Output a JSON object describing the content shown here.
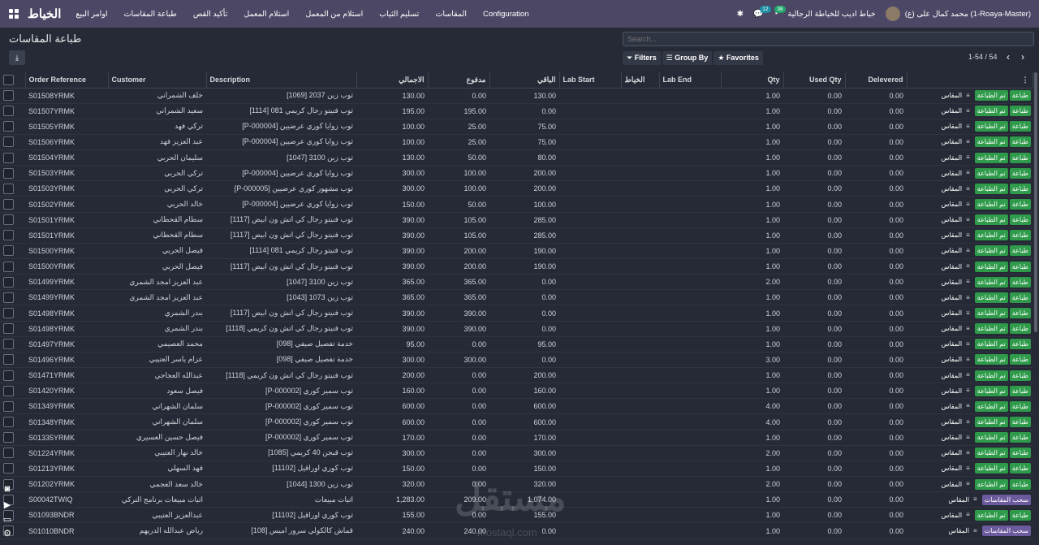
{
  "navbar": {
    "brand": "الخياط",
    "menu": [
      "اوامر البيع",
      "طباعة المقاسات",
      "تأكيد القص",
      "استلام المعمل",
      "استلام من المعمل",
      "تسليم الثياب",
      "المقاسات",
      "Configuration"
    ],
    "messages_count": "12",
    "activity_count": "38",
    "company": "خياط اديب للخياطة الرجالية",
    "user": "محمد كمال على (ع) (1-Roaya-Master)"
  },
  "page": {
    "title": "طباعة المقاسات",
    "search_placeholder": "Search...",
    "filters_label": "Filters",
    "groupby_label": "Group By",
    "favorites_label": "Favorites",
    "pager": "1-54 / 54"
  },
  "columns": [
    "Order Reference",
    "Customer",
    "Description",
    "الاجمالي",
    "مدفوع",
    "الباقي",
    "Lab Start",
    "الخياط",
    "Lab End",
    "Qty",
    "Used Qty",
    "Delevered"
  ],
  "actions": {
    "print_done": "تم الطباعة",
    "print": "طباعة",
    "measure": "المقاس",
    "withdraw": "سحب المقاسات"
  },
  "rows": [
    {
      "ref": "S01508YRMK",
      "customer": "خلف الشمراني",
      "desc": "ثوب زين 2037 [1069]",
      "total": "130.00",
      "paid": "0.00",
      "rest": "130.00",
      "qty": "1.00",
      "used": "0.00",
      "del": "0.00",
      "a": "p"
    },
    {
      "ref": "S01507YRMK",
      "customer": "سعيد الشمراني",
      "desc": "ثوب فنيتو رجال كريمي 081 [1114]",
      "total": "195.00",
      "paid": "195.00",
      "rest": "0.00",
      "qty": "1.00",
      "used": "0.00",
      "del": "0.00",
      "a": "p"
    },
    {
      "ref": "S01505YRMK",
      "customer": "تركي فهد",
      "desc": "ثوب زوايا كوري عرضيين [P-000004]",
      "total": "100.00",
      "paid": "25.00",
      "rest": "75.00",
      "qty": "1.00",
      "used": "0.00",
      "del": "0.00",
      "a": "p"
    },
    {
      "ref": "S01506YRMK",
      "customer": "عبد العزيز فهد",
      "desc": "ثوب زوايا كوري عرضيين [P-000004]",
      "total": "100.00",
      "paid": "25.00",
      "rest": "75.00",
      "qty": "1.00",
      "used": "0.00",
      "del": "0.00",
      "a": "p"
    },
    {
      "ref": "S01504YRMK",
      "customer": "سليمان الحربي",
      "desc": "ثوب زين 3100 [1047]",
      "total": "130.00",
      "paid": "50.00",
      "rest": "80.00",
      "qty": "1.00",
      "used": "0.00",
      "del": "0.00",
      "a": "p"
    },
    {
      "ref": "S01503YRMK",
      "customer": "تركي الحربي",
      "desc": "ثوب زوايا كوري عرضيين [P-000004]",
      "total": "300.00",
      "paid": "100.00",
      "rest": "200.00",
      "qty": "1.00",
      "used": "0.00",
      "del": "0.00",
      "a": "p"
    },
    {
      "ref": "S01503YRMK",
      "customer": "تركي الحربي",
      "desc": "ثوب مشهور كوري عرضيين [P-000005]",
      "total": "300.00",
      "paid": "100.00",
      "rest": "200.00",
      "qty": "1.00",
      "used": "0.00",
      "del": "0.00",
      "a": "p"
    },
    {
      "ref": "S01502YRMK",
      "customer": "خالد الحربي",
      "desc": "ثوب زوايا كوري عرضيين [P-000004]",
      "total": "150.00",
      "paid": "50.00",
      "rest": "100.00",
      "qty": "1.00",
      "used": "0.00",
      "del": "0.00",
      "a": "p"
    },
    {
      "ref": "S01501YRMK",
      "customer": "سطام القحطاني",
      "desc": "ثوب فنيتو رجال كي اتش ون ابيض [1117]",
      "total": "390.00",
      "paid": "105.00",
      "rest": "285.00",
      "qty": "1.00",
      "used": "0.00",
      "del": "0.00",
      "a": "p"
    },
    {
      "ref": "S01501YRMK",
      "customer": "سطام القحطاني",
      "desc": "ثوب فنيتو رجال كي اتش ون ابيض [1117]",
      "total": "390.00",
      "paid": "105.00",
      "rest": "285.00",
      "qty": "1.00",
      "used": "0.00",
      "del": "0.00",
      "a": "p"
    },
    {
      "ref": "S01500YRMK",
      "customer": "فيصل الحربي",
      "desc": "ثوب فنيتو رجال كريمي 081 [1114]",
      "total": "390.00",
      "paid": "200.00",
      "rest": "190.00",
      "qty": "1.00",
      "used": "0.00",
      "del": "0.00",
      "a": "p"
    },
    {
      "ref": "S01500YRMK",
      "customer": "فيصل الحربي",
      "desc": "ثوب فنيتو رجال كي اتش ون ابيض [1117]",
      "total": "390.00",
      "paid": "200.00",
      "rest": "190.00",
      "qty": "1.00",
      "used": "0.00",
      "del": "0.00",
      "a": "p"
    },
    {
      "ref": "S01499YRMK",
      "customer": "عبد العزيز امجد الشمري",
      "desc": "ثوب زين 3100 [1047]",
      "total": "365.00",
      "paid": "365.00",
      "rest": "0.00",
      "qty": "2.00",
      "used": "0.00",
      "del": "0.00",
      "a": "p"
    },
    {
      "ref": "S01499YRMK",
      "customer": "عبد العزيز امجد الشمري",
      "desc": "ثوب زين 1073 [1043]",
      "total": "365.00",
      "paid": "365.00",
      "rest": "0.00",
      "qty": "1.00",
      "used": "0.00",
      "del": "0.00",
      "a": "p"
    },
    {
      "ref": "S01498YRMK",
      "customer": "بندر الشمري",
      "desc": "ثوب فنيتو رجال كي اتش ون ابيض [1117]",
      "total": "390.00",
      "paid": "390.00",
      "rest": "0.00",
      "qty": "1.00",
      "used": "0.00",
      "del": "0.00",
      "a": "p"
    },
    {
      "ref": "S01498YRMK",
      "customer": "بندر الشمري",
      "desc": "ثوب فنيتو رجال كي اتش ون كريمي [1118]",
      "total": "390.00",
      "paid": "390.00",
      "rest": "0.00",
      "qty": "1.00",
      "used": "0.00",
      "del": "0.00",
      "a": "p"
    },
    {
      "ref": "S01497YRMK",
      "customer": "محمد العصيمي",
      "desc": "خدمة تفصيل صيفي [098]",
      "total": "95.00",
      "paid": "0.00",
      "rest": "95.00",
      "qty": "1.00",
      "used": "0.00",
      "del": "0.00",
      "a": "p"
    },
    {
      "ref": "S01496YRMK",
      "customer": "عزام ياسر العتيبي",
      "desc": "خدمة تفصيل صيفي [098]",
      "total": "300.00",
      "paid": "300.00",
      "rest": "0.00",
      "qty": "3.00",
      "used": "0.00",
      "del": "0.00",
      "a": "p"
    },
    {
      "ref": "S01471YRMK",
      "customer": "عبدالله العجاجي",
      "desc": "ثوب فنيتو رجال كي اتش ون كريمي [1118]",
      "total": "200.00",
      "paid": "0.00",
      "rest": "200.00",
      "qty": "1.00",
      "used": "0.00",
      "del": "0.00",
      "a": "p"
    },
    {
      "ref": "S01420YRMK",
      "customer": "فيصل سعود",
      "desc": "ثوب سمير كوري [P-000002]",
      "total": "160.00",
      "paid": "0.00",
      "rest": "160.00",
      "qty": "1.00",
      "used": "0.00",
      "del": "0.00",
      "a": "p"
    },
    {
      "ref": "S01349YRMK",
      "customer": "سلمان الشهراني",
      "desc": "ثوب سمير كوري [P-000002]",
      "total": "600.00",
      "paid": "0.00",
      "rest": "600.00",
      "qty": "4.00",
      "used": "0.00",
      "del": "0.00",
      "a": "p"
    },
    {
      "ref": "S01348YRMK",
      "customer": "سلمان الشهراني",
      "desc": "ثوب سمير كوري [P-000002]",
      "total": "600.00",
      "paid": "0.00",
      "rest": "600.00",
      "qty": "4.00",
      "used": "0.00",
      "del": "0.00",
      "a": "p"
    },
    {
      "ref": "S01335YRMK",
      "customer": "فيصل حسين العسيري",
      "desc": "ثوب سمير كوري [P-000002]",
      "total": "170.00",
      "paid": "0.00",
      "rest": "170.00",
      "qty": "1.00",
      "used": "0.00",
      "del": "0.00",
      "a": "p"
    },
    {
      "ref": "S01224YRMK",
      "customer": "خالد نهار العتيبي",
      "desc": "ثوب قبجن 40 كريمي [1085]",
      "total": "300.00",
      "paid": "0.00",
      "rest": "300.00",
      "qty": "2.00",
      "used": "0.00",
      "del": "0.00",
      "a": "p"
    },
    {
      "ref": "S01213YRMK",
      "customer": "فهد السهلي",
      "desc": "ثوب كوري اوراقيل [11102]",
      "total": "150.00",
      "paid": "0.00",
      "rest": "150.00",
      "qty": "1.00",
      "used": "0.00",
      "del": "0.00",
      "a": "p"
    },
    {
      "ref": "S01202YRMK",
      "customer": "خالد سعد العجمي",
      "desc": "ثوب زين 1300 [1044]",
      "total": "320.00",
      "paid": "0.00",
      "rest": "320.00",
      "qty": "2.00",
      "used": "0.00",
      "del": "0.00",
      "a": "p"
    },
    {
      "ref": "S00042TWIQ",
      "customer": "اثبات مبيعات برنامج التركي",
      "desc": "اثبات مبيعات",
      "total": "1,283.00",
      "paid": "209.00",
      "rest": "1,074.00",
      "qty": "1.00",
      "used": "0.00",
      "del": "0.00",
      "a": "w"
    },
    {
      "ref": "S01093BNDR",
      "customer": "عبدالعزيز العتيبي",
      "desc": "ثوب كوري اوراقيل [11102]",
      "total": "155.00",
      "paid": "0.00",
      "rest": "155.00",
      "qty": "1.00",
      "used": "0.00",
      "del": "0.00",
      "a": "p"
    },
    {
      "ref": "S01010BNDR",
      "customer": "رياض عبدالله الدريهم",
      "desc": "قماش كالكولي سرور اميس [108]",
      "total": "240.00",
      "paid": "240.00",
      "rest": "0.00",
      "qty": "1.00",
      "used": "0.00",
      "del": "0.00",
      "a": "w"
    }
  ],
  "watermark": {
    "main": "مستقل",
    "sub": "mostaql.com"
  }
}
